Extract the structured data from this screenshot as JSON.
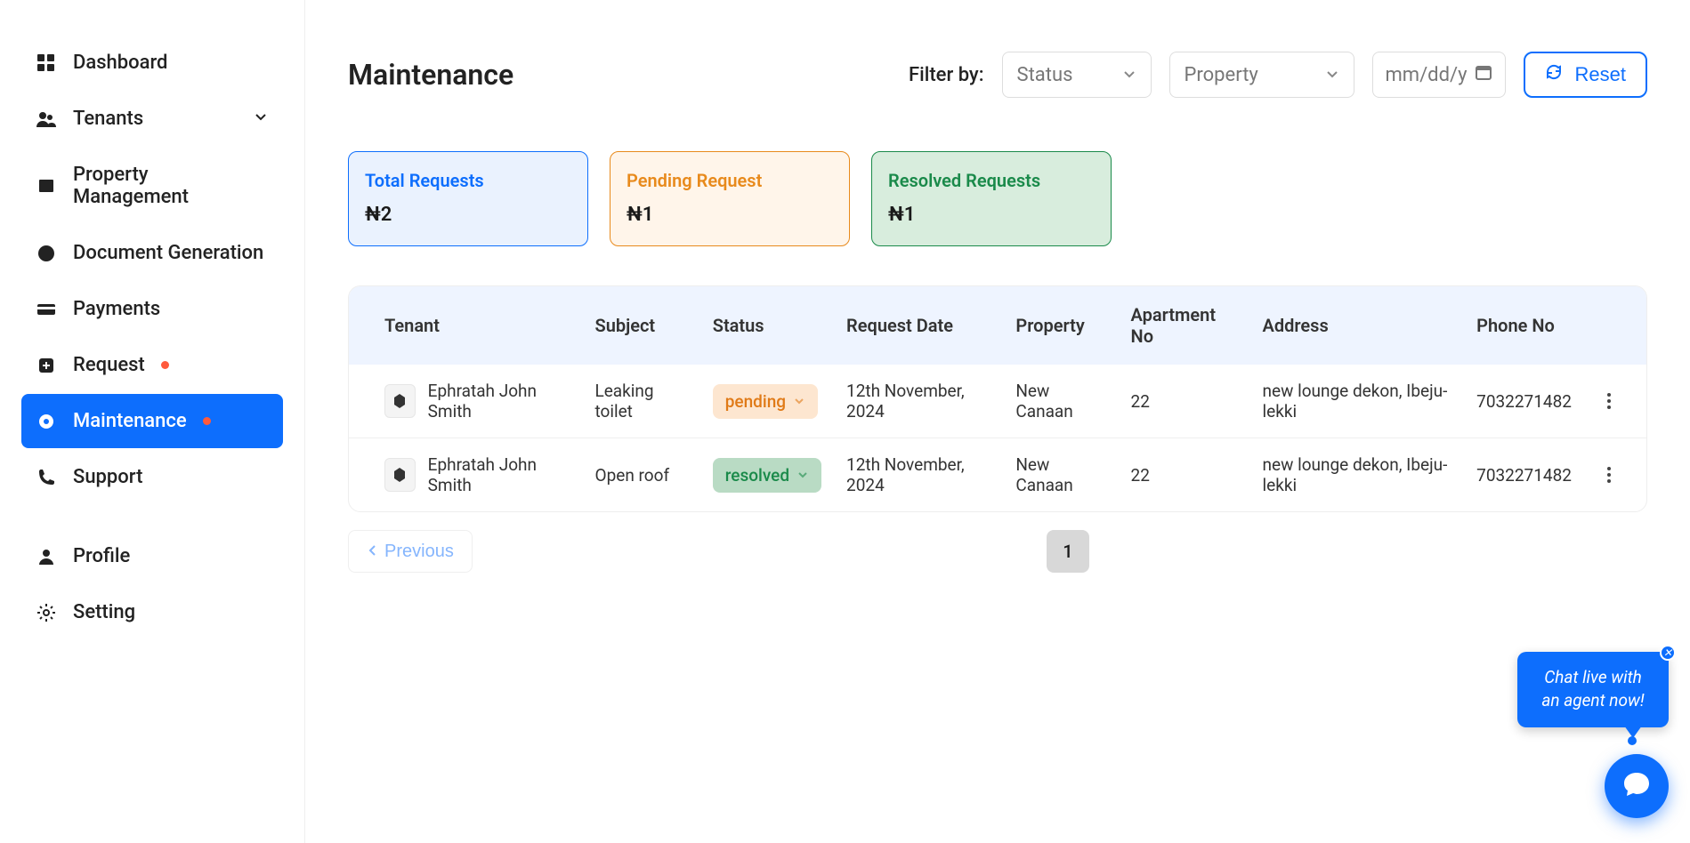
{
  "sidebar": {
    "dashboard": "Dashboard",
    "tenants": "Tenants",
    "property_management": "Property Management",
    "document_generation": "Document Generation",
    "payments": "Payments",
    "request": "Request",
    "maintenance": "Maintenance",
    "support": "Support",
    "profile": "Profile",
    "setting": "Setting"
  },
  "header": {
    "title": "Maintenance",
    "filter_label": "Filter by:",
    "status_placeholder": "Status",
    "property_placeholder": "Property",
    "date_placeholder": "mm/dd/y",
    "reset": "Reset"
  },
  "cards": {
    "total": {
      "title": "Total Requests",
      "value": "2"
    },
    "pending": {
      "title": "Pending Request",
      "value": "1"
    },
    "resolved": {
      "title": "Resolved Requests",
      "value": "1"
    }
  },
  "table": {
    "headers": {
      "tenant": "Tenant",
      "subject": "Subject",
      "status": "Status",
      "request_date": "Request Date",
      "property": "Property",
      "apartment_no": "Apartment No",
      "address": "Address",
      "phone_no": "Phone No"
    },
    "rows": [
      {
        "tenant": "Ephratah John Smith",
        "subject": "Leaking toilet",
        "status": "pending",
        "request_date": "12th November, 2024",
        "property": "New Canaan",
        "apartment_no": "22",
        "address": "new lounge dekon, Ibeju-lekki",
        "phone_no": "7032271482"
      },
      {
        "tenant": "Ephratah John Smith",
        "subject": "Open roof",
        "status": "resolved",
        "request_date": "12th November, 2024",
        "property": "New Canaan",
        "apartment_no": "22",
        "address": "new lounge dekon, Ibeju-lekki",
        "phone_no": "7032271482"
      }
    ]
  },
  "pagination": {
    "previous": "Previous",
    "page": "1"
  },
  "chat": {
    "tooltip": "Chat live with an agent now!"
  }
}
